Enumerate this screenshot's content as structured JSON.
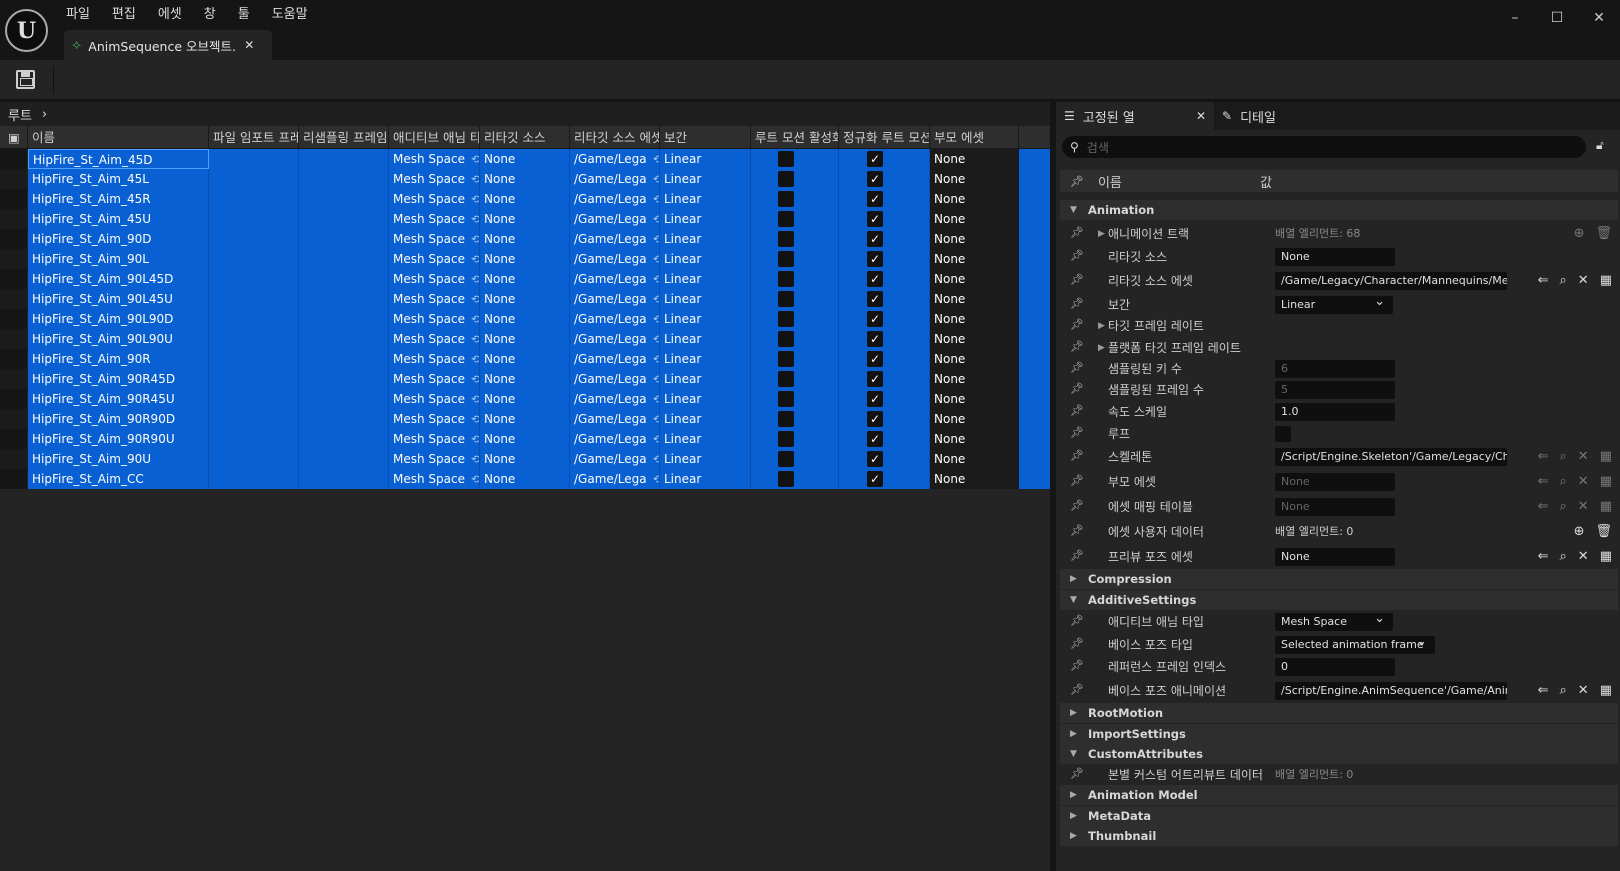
{
  "app": {
    "logo": "U"
  },
  "menu": [
    "파일",
    "편집",
    "에셋",
    "창",
    "툴",
    "도움말"
  ],
  "doc_tab": {
    "title": "AnimSequence 오브젝트...",
    "icon": "anim-sequence-icon"
  },
  "left": {
    "breadcrumb": "루트",
    "columns": [
      "이름",
      "파일 임포트 프레",
      "리샘플링 프레임",
      "애디티브 애님 타",
      "리타깃 소스",
      "리타깃 소스 에셋",
      "보간",
      "루트 모션 활성화",
      "정규화 루트 모션",
      "부모 에셋"
    ],
    "rows": [
      {
        "name": "HipFire_St_Aim_45D",
        "additive": "Mesh Space",
        "retarget": "None",
        "asset": "/Game/Lega",
        "interp": "Linear",
        "root_motion": false,
        "normalize": true,
        "parent": "None"
      },
      {
        "name": "HipFire_St_Aim_45L",
        "additive": "Mesh Space",
        "retarget": "None",
        "asset": "/Game/Lega",
        "interp": "Linear",
        "root_motion": false,
        "normalize": true,
        "parent": "None"
      },
      {
        "name": "HipFire_St_Aim_45R",
        "additive": "Mesh Space",
        "retarget": "None",
        "asset": "/Game/Lega",
        "interp": "Linear",
        "root_motion": false,
        "normalize": true,
        "parent": "None"
      },
      {
        "name": "HipFire_St_Aim_45U",
        "additive": "Mesh Space",
        "retarget": "None",
        "asset": "/Game/Lega",
        "interp": "Linear",
        "root_motion": false,
        "normalize": true,
        "parent": "None"
      },
      {
        "name": "HipFire_St_Aim_90D",
        "additive": "Mesh Space",
        "retarget": "None",
        "asset": "/Game/Lega",
        "interp": "Linear",
        "root_motion": false,
        "normalize": true,
        "parent": "None"
      },
      {
        "name": "HipFire_St_Aim_90L",
        "additive": "Mesh Space",
        "retarget": "None",
        "asset": "/Game/Lega",
        "interp": "Linear",
        "root_motion": false,
        "normalize": true,
        "parent": "None"
      },
      {
        "name": "HipFire_St_Aim_90L45D",
        "additive": "Mesh Space",
        "retarget": "None",
        "asset": "/Game/Lega",
        "interp": "Linear",
        "root_motion": false,
        "normalize": true,
        "parent": "None"
      },
      {
        "name": "HipFire_St_Aim_90L45U",
        "additive": "Mesh Space",
        "retarget": "None",
        "asset": "/Game/Lega",
        "interp": "Linear",
        "root_motion": false,
        "normalize": true,
        "parent": "None"
      },
      {
        "name": "HipFire_St_Aim_90L90D",
        "additive": "Mesh Space",
        "retarget": "None",
        "asset": "/Game/Lega",
        "interp": "Linear",
        "root_motion": false,
        "normalize": true,
        "parent": "None"
      },
      {
        "name": "HipFire_St_Aim_90L90U",
        "additive": "Mesh Space",
        "retarget": "None",
        "asset": "/Game/Lega",
        "interp": "Linear",
        "root_motion": false,
        "normalize": true,
        "parent": "None"
      },
      {
        "name": "HipFire_St_Aim_90R",
        "additive": "Mesh Space",
        "retarget": "None",
        "asset": "/Game/Lega",
        "interp": "Linear",
        "root_motion": false,
        "normalize": true,
        "parent": "None"
      },
      {
        "name": "HipFire_St_Aim_90R45D",
        "additive": "Mesh Space",
        "retarget": "None",
        "asset": "/Game/Lega",
        "interp": "Linear",
        "root_motion": false,
        "normalize": true,
        "parent": "None"
      },
      {
        "name": "HipFire_St_Aim_90R45U",
        "additive": "Mesh Space",
        "retarget": "None",
        "asset": "/Game/Lega",
        "interp": "Linear",
        "root_motion": false,
        "normalize": true,
        "parent": "None"
      },
      {
        "name": "HipFire_St_Aim_90R90D",
        "additive": "Mesh Space",
        "retarget": "None",
        "asset": "/Game/Lega",
        "interp": "Linear",
        "root_motion": false,
        "normalize": true,
        "parent": "None"
      },
      {
        "name": "HipFire_St_Aim_90R90U",
        "additive": "Mesh Space",
        "retarget": "None",
        "asset": "/Game/Lega",
        "interp": "Linear",
        "root_motion": false,
        "normalize": true,
        "parent": "None"
      },
      {
        "name": "HipFire_St_Aim_90U",
        "additive": "Mesh Space",
        "retarget": "None",
        "asset": "/Game/Lega",
        "interp": "Linear",
        "root_motion": false,
        "normalize": true,
        "parent": "None"
      },
      {
        "name": "HipFire_St_Aim_CC",
        "additive": "Mesh Space",
        "retarget": "None",
        "asset": "/Game/Lega",
        "interp": "Linear",
        "root_motion": false,
        "normalize": true,
        "parent": "None"
      }
    ]
  },
  "right": {
    "tabs": [
      "고정된 열",
      "디테일"
    ],
    "search_placeholder": "검색",
    "header": {
      "name": "이름",
      "value": "값"
    },
    "categories": {
      "animation": "Animation",
      "compression": "Compression",
      "additive": "AdditiveSettings",
      "rootmotion": "RootMotion",
      "import": "ImportSettings",
      "custom": "CustomAttributes",
      "anim_model": "Animation Model",
      "metadata": "MetaData",
      "thumbnail": "Thumbnail"
    },
    "props": {
      "anim_track": {
        "name": "애니메이션 트랙",
        "value": "배열 엘리먼트: 68"
      },
      "retarget_src": {
        "name": "리타깃 소스",
        "value": "None"
      },
      "retarget_asset": {
        "name": "리타깃 소스 에셋",
        "value": "/Game/Legacy/Character/Mannequins/Me"
      },
      "interp": {
        "name": "보간",
        "value": "Linear"
      },
      "target_fr": {
        "name": "타깃 프레임 레이트"
      },
      "platform_fr": {
        "name": "플랫폼 타깃 프레임 레이트"
      },
      "sampled_keys": {
        "name": "샘플링된 키 수",
        "value": "6"
      },
      "sampled_frames": {
        "name": "샘플링된 프레임 수",
        "value": "5"
      },
      "rate_scale": {
        "name": "속도 스케일",
        "value": "1.0"
      },
      "loop": {
        "name": "루프"
      },
      "skeleton": {
        "name": "스켈레톤",
        "value": "/Script/Engine.Skeleton'/Game/Legacy/Cha"
      },
      "parent_asset": {
        "name": "부모 에셋",
        "value": "None"
      },
      "asset_map": {
        "name": "에셋 매핑 테이블",
        "value": "None"
      },
      "user_data": {
        "name": "에셋 사용자 데이터",
        "value": "배열 엘리먼트: 0"
      },
      "preview_pose": {
        "name": "프리뷰 포즈 에셋",
        "value": "None"
      },
      "additive_type": {
        "name": "애디티브 애님 타입",
        "value": "Mesh Space"
      },
      "base_pose_type": {
        "name": "베이스 포즈 타입",
        "value": "Selected animation frame"
      },
      "ref_frame": {
        "name": "레퍼런스 프레임 인덱스",
        "value": "0"
      },
      "base_pose_anim": {
        "name": "베이스 포즈 애니메이션",
        "value": "/Script/Engine.AnimSequence'/Game/Anim"
      },
      "bone_custom": {
        "name": "본별 커스텀 어트리뷰트 데이터",
        "value": "배열 엘리먼트: 0"
      }
    }
  }
}
